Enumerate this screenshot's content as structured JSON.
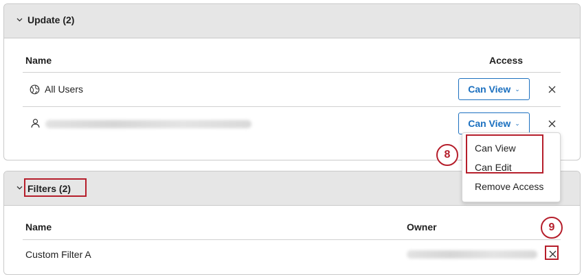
{
  "update_section": {
    "title": "Update (2)",
    "columns": {
      "name": "Name",
      "access": "Access"
    },
    "rows": [
      {
        "name": "All Users",
        "icon": "globe-icon",
        "access": "Can View"
      },
      {
        "name": "",
        "icon": "user-icon",
        "access": "Can View"
      }
    ]
  },
  "access_menu": {
    "items": [
      "Can View",
      "Can Edit",
      "Remove Access"
    ]
  },
  "filters_section": {
    "title": "Filters (2)",
    "columns": {
      "name": "Name",
      "owner": "Owner"
    },
    "rows": [
      {
        "name": "Custom Filter A",
        "owner": ""
      }
    ]
  },
  "annotations": {
    "step_8": "8",
    "step_9": "9",
    "highlight_color": "#b51d2a"
  },
  "colors": {
    "accent": "#1a6fbf",
    "header_bg": "#e6e6e6"
  }
}
